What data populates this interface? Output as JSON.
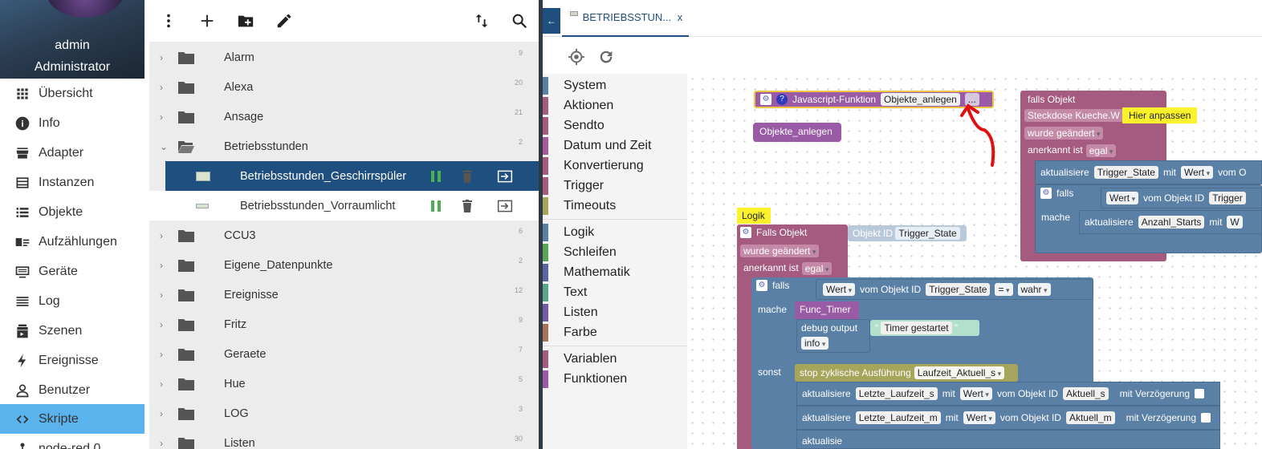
{
  "user": {
    "name": "admin",
    "role": "Administrator"
  },
  "nav": [
    {
      "label": "Übersicht",
      "icon": "grid-icon"
    },
    {
      "label": "Info",
      "icon": "info-icon"
    },
    {
      "label": "Adapter",
      "icon": "store-icon"
    },
    {
      "label": "Instanzen",
      "icon": "instances-icon"
    },
    {
      "label": "Objekte",
      "icon": "list-icon"
    },
    {
      "label": "Aufzählungen",
      "icon": "enum-icon"
    },
    {
      "label": "Geräte",
      "icon": "devices-icon"
    },
    {
      "label": "Log",
      "icon": "log-icon"
    },
    {
      "label": "Szenen",
      "icon": "scenes-icon"
    },
    {
      "label": "Ereignisse",
      "icon": "lightning-icon"
    },
    {
      "label": "Benutzer",
      "icon": "user-icon"
    },
    {
      "label": "Skripte",
      "icon": "code-icon",
      "active": true
    },
    {
      "label": "node-red.0",
      "icon": "node-red-icon"
    }
  ],
  "tree": {
    "rows": [
      {
        "type": "folder",
        "label": "Alarm",
        "count": "9"
      },
      {
        "type": "folder",
        "label": "Alexa",
        "count": "20"
      },
      {
        "type": "folder",
        "label": "Ansage",
        "count": "21"
      },
      {
        "type": "folder-open",
        "label": "Betriebsstunden",
        "count": "2"
      },
      {
        "type": "script",
        "label": "Betriebsstunden_Geschirrspüler",
        "selected": true
      },
      {
        "type": "script",
        "label": "Betriebsstunden_Vorraumlicht"
      },
      {
        "type": "folder",
        "label": "CCU3",
        "count": "6"
      },
      {
        "type": "folder",
        "label": "Eigene_Datenpunkte",
        "count": "2"
      },
      {
        "type": "folder",
        "label": "Ereignisse",
        "count": "12"
      },
      {
        "type": "folder",
        "label": "Fritz",
        "count": "9"
      },
      {
        "type": "folder",
        "label": "Geraete",
        "count": "7"
      },
      {
        "type": "folder",
        "label": "Hue",
        "count": "5"
      },
      {
        "type": "folder",
        "label": "LOG",
        "count": "3"
      },
      {
        "type": "folder",
        "label": "Listen",
        "count": "30"
      }
    ]
  },
  "editor": {
    "tab_label": "BETRIEBSSTUN...",
    "tab_close": "x",
    "categories_group1": [
      {
        "label": "System",
        "color": "#5b80a5"
      },
      {
        "label": "Aktionen",
        "color": "#a55b80"
      },
      {
        "label": "Sendto",
        "color": "#a55b80"
      },
      {
        "label": "Datum und Zeit",
        "color": "#a55b99"
      },
      {
        "label": "Konvertierung",
        "color": "#a55b80"
      },
      {
        "label": "Trigger",
        "color": "#a55b80"
      },
      {
        "label": "Timeouts",
        "color": "#a5a55b"
      }
    ],
    "categories_group2": [
      {
        "label": "Logik",
        "color": "#5b80a5"
      },
      {
        "label": "Schleifen",
        "color": "#5ba55b"
      },
      {
        "label": "Mathematik",
        "color": "#5b67a5"
      },
      {
        "label": "Text",
        "color": "#5ba58c"
      },
      {
        "label": "Listen",
        "color": "#745ba5"
      },
      {
        "label": "Farbe",
        "color": "#a5745b"
      }
    ],
    "categories_group3": [
      {
        "label": "Variablen",
        "color": "#a55b80"
      },
      {
        "label": "Funktionen",
        "color": "#995ba5"
      }
    ]
  },
  "blocks": {
    "func_def": {
      "label": "Javascript-Funktion",
      "name": "Objekte_anlegen",
      "more": "..."
    },
    "func_call": "Objekte_anlegen",
    "comment_logik": "Logik",
    "trigger_main": {
      "title": "Falls Objekt",
      "id_label": "Objekt ID",
      "id_value": "Trigger_State",
      "changed": "wurde geändert",
      "ack_label": "anerkannt ist",
      "ack_value": "egal",
      "if_label": "falls",
      "value_label": "Wert",
      "of_object": "vom Objekt ID",
      "object": "Trigger_State",
      "op": "=",
      "bool": "wahr",
      "do_label": "mache",
      "func_timer": "Func_Timer",
      "debug_label": "debug output",
      "debug_text": "Timer gestartet",
      "debug_level": "info",
      "else_label": "sonst",
      "stop_label": "stop zyklische Ausführung",
      "stop_value": "Laufzeit_Aktuell_s",
      "upd1_label": "aktualisiere",
      "upd1_target": "Letzte_Laufzeit_s",
      "with": "mit",
      "upd1_source": "Aktuell_s",
      "delay": "mit Verzögerung",
      "upd2_target": "Letzte_Laufzeit_m",
      "upd2_source": "Aktuell_m",
      "upd3_label": "aktualisie"
    },
    "trigger_right": {
      "title": "falls Objekt",
      "object": "Steckdose Kueche.W",
      "note": "Hier anpassen",
      "changed": "wurde geändert",
      "ack_label": "anerkannt ist",
      "ack_value": "egal",
      "upd_label": "aktualisiere",
      "upd_target": "Trigger_State",
      "with": "mit",
      "value_label": "Wert",
      "of_object": "vom O",
      "if_label": "falls",
      "of_object_id": "vom Objekt ID",
      "if_target": "Trigger",
      "do_label": "mache",
      "upd2_target": "Anzahl_Starts",
      "upd2_tail": "W"
    }
  }
}
